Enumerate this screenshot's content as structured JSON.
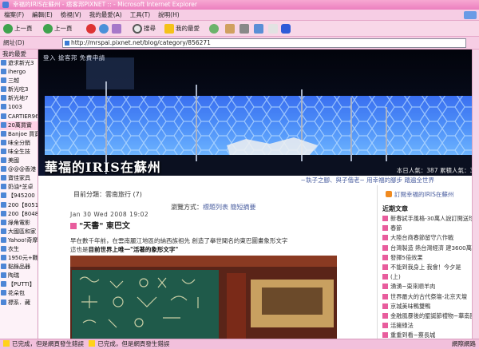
{
  "window": {
    "title": "幸福的IRIS在蘇州 - 痞客邦PIXNET :: - Microsoft Internet Explorer"
  },
  "menu": [
    "檔案(F)",
    "編輯(E)",
    "檢視(V)",
    "我的最愛(A)",
    "工具(T)",
    "說明(H)"
  ],
  "toolbar": {
    "back": "上一頁",
    "forward": "上一頁",
    "search": "搜尋",
    "favorites": "我的最愛"
  },
  "address": {
    "label": "網址(D)",
    "url": "http://mrspai.pixnet.net/blog/category/856271"
  },
  "sidebar": {
    "title": "我的最愛",
    "items": [
      "遊求新光3",
      "ihergo",
      "三越",
      "新光吃3",
      "新光地7",
      "1003",
      "CARTIER96",
      "20萬買實",
      "Banjoe 買寶",
      "味全分銷",
      "味全生技",
      "美國",
      "@@@香港",
      "寶佳家具",
      "奶油*芝卓",
      "【945200",
      "200【8051",
      "200【8048",
      "綠角電影",
      "大國區和家",
      "Yahoo!奇摩",
      "衣生",
      "1950元+戰",
      "黏錄品器",
      "陶瑞",
      "【PUTTI】",
      "花朵包",
      "標系．藏"
    ]
  },
  "banner": {
    "overlay_text": "登入 搶客邦 免費申請",
    "title": "華福的IRIS在蘇州",
    "counter": "本日人氣：387 累積人氣：30"
  },
  "subtitle": "~執子之腳、與子偕老~ 用幸福的腳步 踏遍全世界",
  "category": "目前分類：雲南旅行 (7)",
  "viewmode": {
    "label": "瀏覽方式：",
    "link1": "標題列表",
    "link2": "簡短摘要"
  },
  "post": {
    "date": "Jan 30 Wed 2008 19:02",
    "title": "\"天書\" 東巴文",
    "body1": "早在數千年前，在雲南麗江地區的納西族祖先 創造了舉世聞名的東巴圖畫象形文字",
    "body2_pre": "這也是",
    "body2_bold": "目前世界上唯一\"活著的象形文字\""
  },
  "right": {
    "subscribe": "訂閱幸福的IRIS在蘇州",
    "heading": "近期文章",
    "items": [
      "新春試手風格-30萬人說訂閱送珍",
      "春節",
      "大陸台商春節留守六作戰",
      "台灣製造 熱台灣經濟 建3600萬",
      "發揮5倍效果",
      "不能到我身上 我會！今夕是",
      "(上)",
      "湧湧~東來順羊肉",
      "世界最大的古代祭壇-北京天壇",
      "京城美味鴨雙鴨",
      "金融風暴後的聖誕節禮物~華南國",
      "活擁綠法",
      "重重到看~蔡長城"
    ]
  },
  "status": {
    "text1": "已完成，但是網頁發生錯誤",
    "text2": "已完成，但是網頁發生錯誤",
    "zone": "網際網路"
  }
}
